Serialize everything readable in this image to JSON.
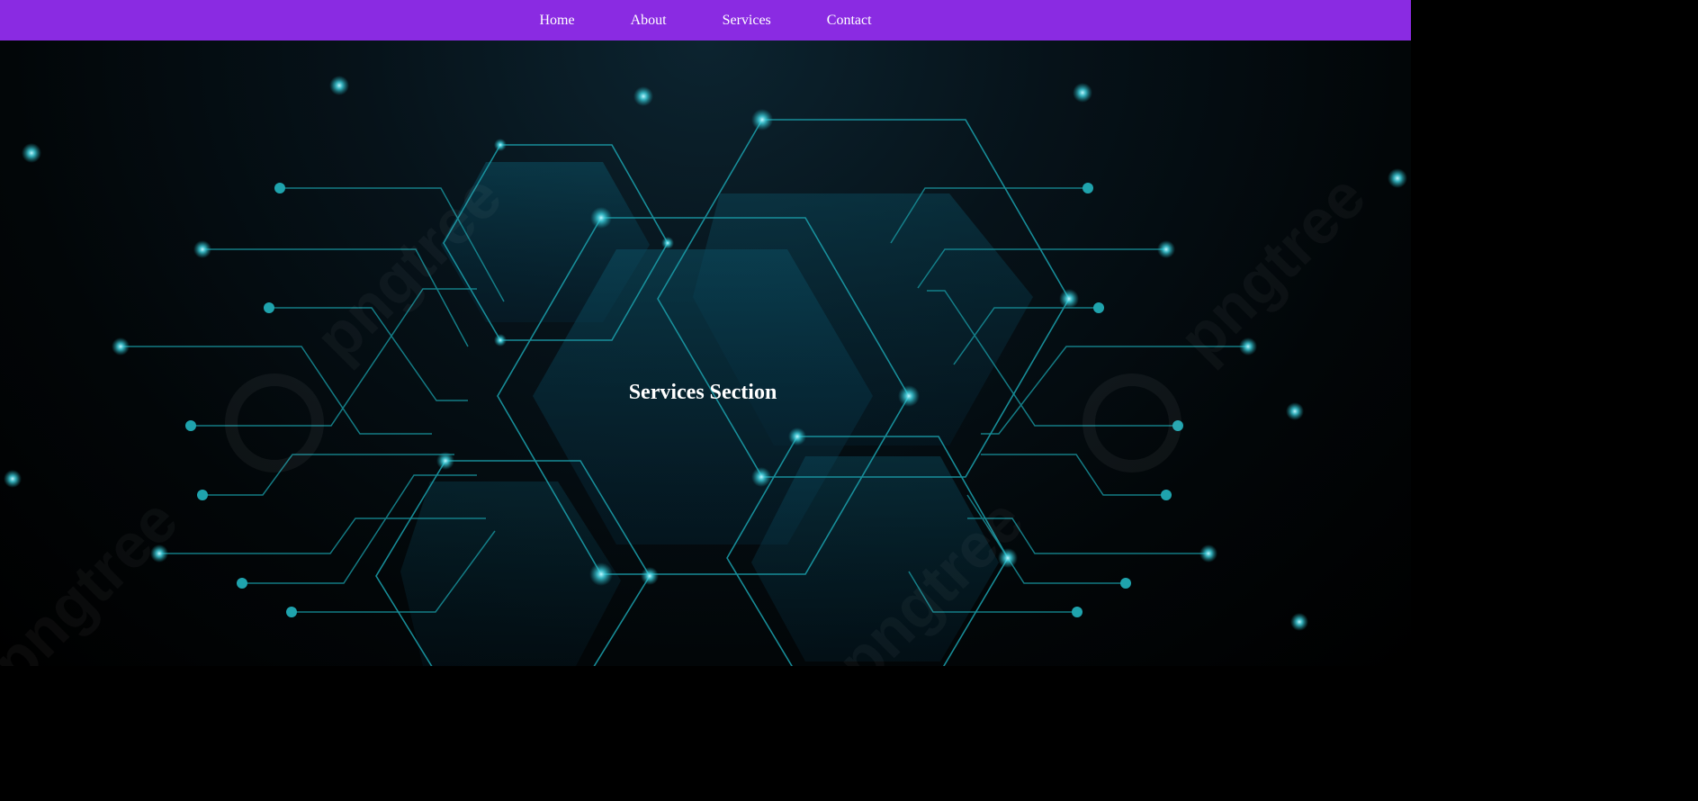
{
  "nav": {
    "items": [
      {
        "label": "Home"
      },
      {
        "label": "About"
      },
      {
        "label": "Services"
      },
      {
        "label": "Contact"
      }
    ]
  },
  "hero": {
    "title": "Services Section",
    "background_image": "hexagon-circuit-board",
    "watermark": "pngtree"
  },
  "colors": {
    "nav_background": "#8a2be2",
    "nav_text": "#ffffff",
    "hero_background": "#000000",
    "circuit_line": "#1fa3ad",
    "hex_fill": "#0a4a5e",
    "title_text": "#ffffff"
  }
}
